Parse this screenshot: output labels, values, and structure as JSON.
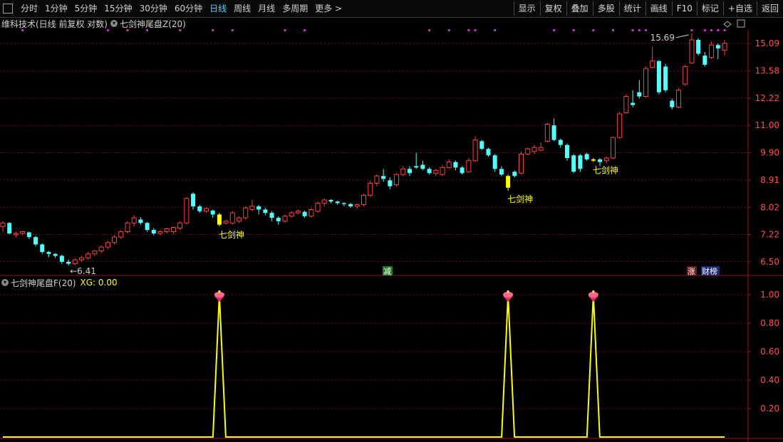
{
  "toolbar": {
    "left_items": [
      "分时",
      "1分钟",
      "5分钟",
      "15分钟",
      "30分钟",
      "60分钟",
      "日线",
      "周线",
      "月线",
      "多周期",
      "更多 >"
    ],
    "active_index": 6,
    "right_items": [
      "显示",
      "复权",
      "叠加",
      "多股",
      "统计",
      "画线",
      "F10",
      "标记",
      "+自选",
      "返回"
    ]
  },
  "main_title": {
    "stock": "维科技术(日线 前复权 对数)",
    "indicator": "七剑神尾盘Z(20)"
  },
  "sub_title": {
    "indicator": "七剑神尾盘F(20)",
    "xg": "XG: 0.00"
  },
  "colors": {
    "up": "#ff4040",
    "down": "#54ffff",
    "signal": "#ffff00",
    "grid": "#7a1010",
    "axis_text": "#ff5050",
    "marker": "#cc33cc"
  },
  "chart_data": [
    {
      "type": "candlestick",
      "scale": "log",
      "ylim": [
        6.2,
        15.9
      ],
      "y_ticks": [
        "15.09",
        "13.58",
        "12.22",
        "11.00",
        "9.90",
        "8.91",
        "8.02",
        "7.22",
        "6.50"
      ],
      "annotations": {
        "high": "15.69",
        "low": "6.41",
        "signal_label": "七剑神",
        "jian_label": "减",
        "zhang_label": "涨",
        "cai_label": "财榜"
      },
      "candles": [
        [
          7.45,
          7.55,
          7.3,
          7.6
        ],
        [
          7.55,
          7.25,
          7.22,
          7.58
        ],
        [
          7.22,
          7.25,
          7.15,
          7.3
        ],
        [
          7.25,
          7.3,
          7.2,
          7.32
        ],
        [
          7.28,
          7.15,
          7.1,
          7.3
        ],
        [
          7.15,
          6.95,
          6.9,
          7.18
        ],
        [
          6.95,
          6.75,
          6.7,
          6.98
        ],
        [
          6.75,
          6.7,
          6.62,
          6.78
        ],
        [
          6.7,
          6.65,
          6.6,
          6.72
        ],
        [
          6.65,
          6.5,
          6.45,
          6.68
        ],
        [
          6.5,
          6.45,
          6.41,
          6.55
        ],
        [
          6.45,
          6.55,
          6.42,
          6.58
        ],
        [
          6.55,
          6.6,
          6.5,
          6.65
        ],
        [
          6.6,
          6.7,
          6.55,
          6.75
        ],
        [
          6.7,
          6.78,
          6.65,
          6.8
        ],
        [
          6.78,
          6.88,
          6.72,
          6.92
        ],
        [
          6.88,
          7.0,
          6.82,
          7.05
        ],
        [
          7.0,
          7.15,
          6.95,
          7.2
        ],
        [
          7.15,
          7.3,
          7.1,
          7.35
        ],
        [
          7.3,
          7.55,
          7.25,
          7.6
        ],
        [
          7.55,
          7.7,
          7.45,
          7.78
        ],
        [
          7.65,
          7.55,
          7.5,
          7.72
        ],
        [
          7.55,
          7.35,
          7.3,
          7.58
        ],
        [
          7.35,
          7.25,
          7.2,
          7.4
        ],
        [
          7.25,
          7.3,
          7.2,
          7.35
        ],
        [
          7.3,
          7.38,
          7.25,
          7.42
        ],
        [
          7.3,
          7.42,
          7.22,
          7.45
        ],
        [
          7.4,
          7.55,
          7.35,
          7.6
        ],
        [
          7.55,
          8.3,
          7.5,
          8.35
        ],
        [
          8.45,
          8.05,
          7.95,
          8.5
        ],
        [
          8.05,
          7.9,
          7.85,
          8.1
        ],
        [
          7.9,
          7.98,
          7.85,
          8.02
        ],
        [
          7.92,
          7.8,
          7.7,
          7.95
        ],
        [
          7.8,
          7.5,
          7.45,
          7.85
        ],
        [
          7.55,
          7.6,
          7.5,
          7.65
        ],
        [
          7.55,
          7.85,
          7.5,
          7.9
        ],
        [
          7.6,
          7.7,
          7.55,
          7.75
        ],
        [
          7.7,
          8.0,
          7.65,
          8.05
        ],
        [
          7.95,
          8.05,
          7.9,
          8.25
        ],
        [
          8.05,
          7.95,
          7.8,
          8.1
        ],
        [
          7.95,
          7.85,
          7.78,
          8.0
        ],
        [
          7.85,
          7.7,
          7.6,
          7.9
        ],
        [
          7.7,
          7.6,
          7.5,
          7.75
        ],
        [
          7.6,
          7.75,
          7.55,
          7.8
        ],
        [
          7.75,
          7.85,
          7.7,
          7.9
        ],
        [
          7.85,
          7.9,
          7.8,
          7.95
        ],
        [
          7.88,
          7.75,
          7.7,
          7.92
        ],
        [
          7.75,
          7.95,
          7.7,
          8.0
        ],
        [
          7.9,
          8.15,
          7.85,
          8.2
        ],
        [
          8.15,
          8.25,
          8.05,
          8.3
        ],
        [
          8.25,
          8.2,
          8.15,
          8.28
        ],
        [
          8.2,
          8.15,
          8.1,
          8.23
        ],
        [
          8.15,
          8.12,
          8.05,
          8.18
        ],
        [
          8.12,
          8.05,
          8.0,
          8.15
        ],
        [
          8.05,
          8.1,
          7.98,
          8.15
        ],
        [
          8.1,
          8.4,
          8.05,
          8.45
        ],
        [
          8.4,
          8.8,
          8.35,
          8.9
        ],
        [
          8.8,
          9.05,
          8.7,
          9.1
        ],
        [
          9.05,
          8.95,
          8.85,
          9.3
        ],
        [
          8.9,
          8.7,
          8.6,
          9.0
        ],
        [
          8.75,
          9.1,
          8.7,
          9.15
        ],
        [
          9.1,
          9.3,
          9.05,
          9.4
        ],
        [
          9.3,
          9.15,
          9.05,
          9.4
        ],
        [
          9.4,
          9.35,
          9.3,
          9.9
        ],
        [
          9.45,
          9.3,
          9.25,
          9.6
        ],
        [
          9.3,
          9.15,
          9.1,
          9.35
        ],
        [
          9.15,
          9.25,
          9.05,
          9.3
        ],
        [
          9.1,
          9.35,
          9.05,
          9.45
        ],
        [
          9.35,
          9.55,
          9.3,
          9.65
        ],
        [
          9.55,
          9.35,
          9.25,
          9.6
        ],
        [
          9.35,
          9.15,
          9.1,
          9.4
        ],
        [
          9.2,
          9.6,
          9.15,
          9.7
        ],
        [
          9.6,
          10.4,
          9.55,
          10.55
        ],
        [
          10.35,
          10.05,
          10.0,
          10.4
        ],
        [
          10.05,
          9.8,
          9.75,
          10.1
        ],
        [
          9.8,
          9.3,
          9.2,
          9.85
        ],
        [
          9.3,
          9.1,
          9.05,
          9.4
        ],
        [
          8.65,
          9.05,
          8.55,
          9.1
        ],
        [
          9.2,
          9.05,
          9.0,
          9.25
        ],
        [
          9.15,
          9.85,
          9.1,
          9.95
        ],
        [
          9.85,
          10.05,
          9.8,
          10.1
        ],
        [
          9.95,
          10.1,
          9.85,
          10.2
        ],
        [
          10.0,
          10.1,
          9.95,
          10.3
        ],
        [
          10.35,
          11.05,
          10.3,
          11.1
        ],
        [
          11.0,
          10.4,
          10.35,
          11.3
        ],
        [
          10.4,
          10.2,
          10.1,
          10.45
        ],
        [
          10.2,
          9.7,
          9.6,
          10.25
        ],
        [
          9.8,
          9.2,
          9.15,
          9.85
        ],
        [
          9.8,
          9.3,
          9.2,
          9.85
        ],
        [
          9.85,
          9.65,
          9.6,
          9.9
        ],
        [
          9.6,
          9.65,
          9.55,
          9.7
        ],
        [
          9.65,
          9.55,
          9.4,
          9.7
        ],
        [
          9.6,
          9.7,
          9.5,
          9.75
        ],
        [
          9.7,
          10.5,
          9.65,
          10.55
        ],
        [
          10.5,
          11.5,
          10.45,
          11.6
        ],
        [
          11.55,
          12.3,
          11.5,
          12.4
        ],
        [
          12.0,
          11.9,
          11.8,
          12.6
        ],
        [
          12.5,
          12.3,
          12.2,
          13.1
        ],
        [
          12.3,
          13.7,
          12.25,
          13.8
        ],
        [
          13.75,
          14.1,
          13.7,
          14.9
        ],
        [
          14.1,
          12.5,
          12.4,
          14.15
        ],
        [
          13.8,
          12.6,
          12.5,
          13.95
        ],
        [
          12.1,
          11.8,
          11.7,
          12.2
        ],
        [
          11.8,
          12.6,
          11.75,
          12.7
        ],
        [
          12.9,
          13.8,
          12.8,
          13.9
        ],
        [
          14.0,
          15.3,
          13.95,
          15.69
        ],
        [
          15.3,
          14.5,
          14.4,
          15.4
        ],
        [
          14.4,
          13.9,
          13.8,
          14.6
        ],
        [
          14.3,
          15.0,
          14.2,
          15.2
        ],
        [
          15.0,
          14.8,
          14.2,
          15.1
        ],
        [
          14.7,
          15.1,
          14.4,
          15.3
        ]
      ],
      "signal_candle_indices": [
        33,
        77,
        90
      ]
    },
    {
      "type": "line",
      "series": [
        {
          "values": [
            0,
            0,
            0,
            0,
            0,
            0,
            0,
            0,
            0,
            0,
            0,
            0,
            0,
            0,
            0,
            0,
            0,
            0,
            0,
            0,
            0,
            0,
            0,
            0,
            0,
            0,
            0,
            0,
            0,
            0,
            0,
            0,
            0,
            1,
            0,
            0,
            0,
            0,
            0,
            0,
            0,
            0,
            0,
            0,
            0,
            0,
            0,
            0,
            0,
            0,
            0,
            0,
            0,
            0,
            0,
            0,
            0,
            0,
            0,
            0,
            0,
            0,
            0,
            0,
            0,
            0,
            0,
            0,
            0,
            0,
            0,
            0,
            0,
            0,
            0,
            0,
            0,
            1,
            0,
            0,
            0,
            0,
            0,
            0,
            0,
            0,
            0,
            0,
            0,
            0,
            1,
            0,
            0,
            0,
            0,
            0,
            0,
            0,
            0,
            0,
            0,
            0,
            0,
            0,
            0,
            0,
            0,
            0,
            0,
            0,
            0
          ]
        }
      ],
      "ylim": [
        0,
        1.0
      ],
      "y_ticks": [
        "1.00",
        "0.80",
        "0.60",
        "0.40",
        "0.20"
      ]
    }
  ]
}
